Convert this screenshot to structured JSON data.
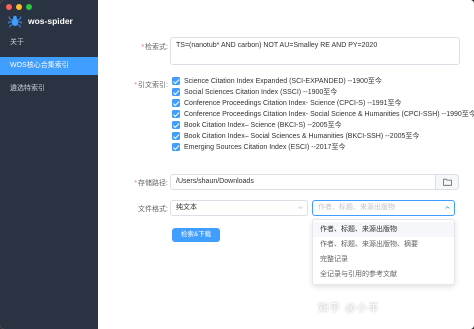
{
  "app": {
    "title": "wos-spider"
  },
  "sidebar": {
    "items": [
      {
        "label": "关于"
      },
      {
        "label": "WOS核心合集索引"
      },
      {
        "label": "遴选特索引"
      }
    ]
  },
  "form": {
    "search_label": "检索式:",
    "search_value": "TS=(nanotub* AND carbon) NOT AU=Smalley RE  AND PY=2020",
    "citation_label": "引文索引:",
    "citations": [
      "Science Citation Index Expanded (SCI-EXPANDED) --1900至今",
      "Social Sciences Citation Index (SSCI) --1900至今",
      "Conference Proceedings Citation Index- Science (CPCI-S) --1991至今",
      "Conference Proceedings Citation Index- Social Science & Humanities (CPCI-SSH) --1990至今",
      "Book Citation Index– Science (BKCI-S) --2005至今",
      "Book Citation Index– Social Sciences & Humanities (BKCI-SSH) --2005至今",
      "Emerging Sources Citation Index (ESCI) --2017至今"
    ],
    "path_label": "存储路径:",
    "path_value": "/Users/shaun/Downloads",
    "format_label": "文件格式:",
    "format_value": "纯文本",
    "record_placeholder": "作者、标题、来源出版物",
    "submit_label": "检索&下载"
  },
  "dropdown": {
    "options": [
      "作者、标题、来源出版物",
      "作者、标题、来源出版物、摘要",
      "完整记录",
      "全记录与引用的参考文献"
    ]
  },
  "watermark": "知乎 @小羊",
  "colors": {
    "sidebar": "#2a3342",
    "accent": "#409eff",
    "required": "#f56c6c"
  }
}
